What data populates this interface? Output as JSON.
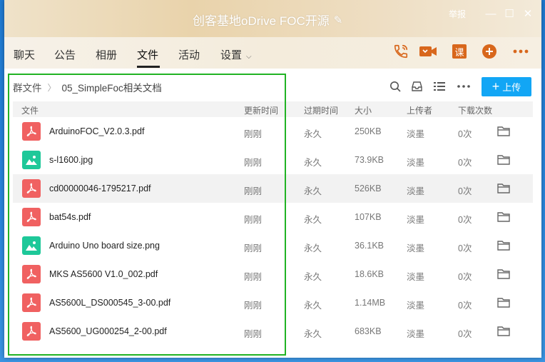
{
  "window": {
    "title": "创客基地oDrive FOC开源",
    "report_label": "举报",
    "min_glyph": "—",
    "max_glyph": "☐",
    "close_glyph": "✕"
  },
  "tabs": [
    {
      "label": "聊天"
    },
    {
      "label": "公告"
    },
    {
      "label": "相册"
    },
    {
      "label": "文件"
    },
    {
      "label": "活动"
    },
    {
      "label": "设置"
    }
  ],
  "header_icons": [
    "phone-icon",
    "video-icon",
    "class-icon",
    "plus-circle-icon",
    "more-icon"
  ],
  "class_icon_text": "课",
  "breadcrumb": {
    "root": "群文件",
    "current": "05_SimpleFoc相关文档"
  },
  "toolbar": {
    "upload_label": "上传"
  },
  "table": {
    "headers": {
      "file": "文件",
      "updated": "更新时间",
      "expires": "过期时间",
      "size": "大小",
      "uploader": "上传者",
      "downloads": "下载次数"
    },
    "rows": [
      {
        "name": "ArduinoFOC_V2.0.3.pdf",
        "type": "pdf",
        "updated": "刚刚",
        "expires": "永久",
        "size": "250KB",
        "uploader": "淡墨",
        "downloads": "0次"
      },
      {
        "name": "s-l1600.jpg",
        "type": "img",
        "updated": "刚刚",
        "expires": "永久",
        "size": "73.9KB",
        "uploader": "淡墨",
        "downloads": "0次"
      },
      {
        "name": "cd00000046-1795217.pdf",
        "type": "pdf",
        "updated": "刚刚",
        "expires": "永久",
        "size": "526KB",
        "uploader": "淡墨",
        "downloads": "0次"
      },
      {
        "name": "bat54s.pdf",
        "type": "pdf",
        "updated": "刚刚",
        "expires": "永久",
        "size": "107KB",
        "uploader": "淡墨",
        "downloads": "0次"
      },
      {
        "name": "Arduino Uno board size.png",
        "type": "img",
        "updated": "刚刚",
        "expires": "永久",
        "size": "36.1KB",
        "uploader": "淡墨",
        "downloads": "0次"
      },
      {
        "name": "MKS AS5600 V1.0_002.pdf",
        "type": "pdf",
        "updated": "刚刚",
        "expires": "永久",
        "size": "18.6KB",
        "uploader": "淡墨",
        "downloads": "0次"
      },
      {
        "name": "AS5600L_DS000545_3-00.pdf",
        "type": "pdf",
        "updated": "刚刚",
        "expires": "永久",
        "size": "1.14MB",
        "uploader": "淡墨",
        "downloads": "0次"
      },
      {
        "name": "AS5600_UG000254_2-00.pdf",
        "type": "pdf",
        "updated": "刚刚",
        "expires": "永久",
        "size": "683KB",
        "uploader": "淡墨",
        "downloads": "0次"
      }
    ]
  },
  "colors": {
    "accent": "#12a6f5",
    "pdf_icon": "#f06161",
    "image_icon": "#1ec899",
    "header_icon": "#d8671c",
    "highlight_border": "#21b324"
  }
}
